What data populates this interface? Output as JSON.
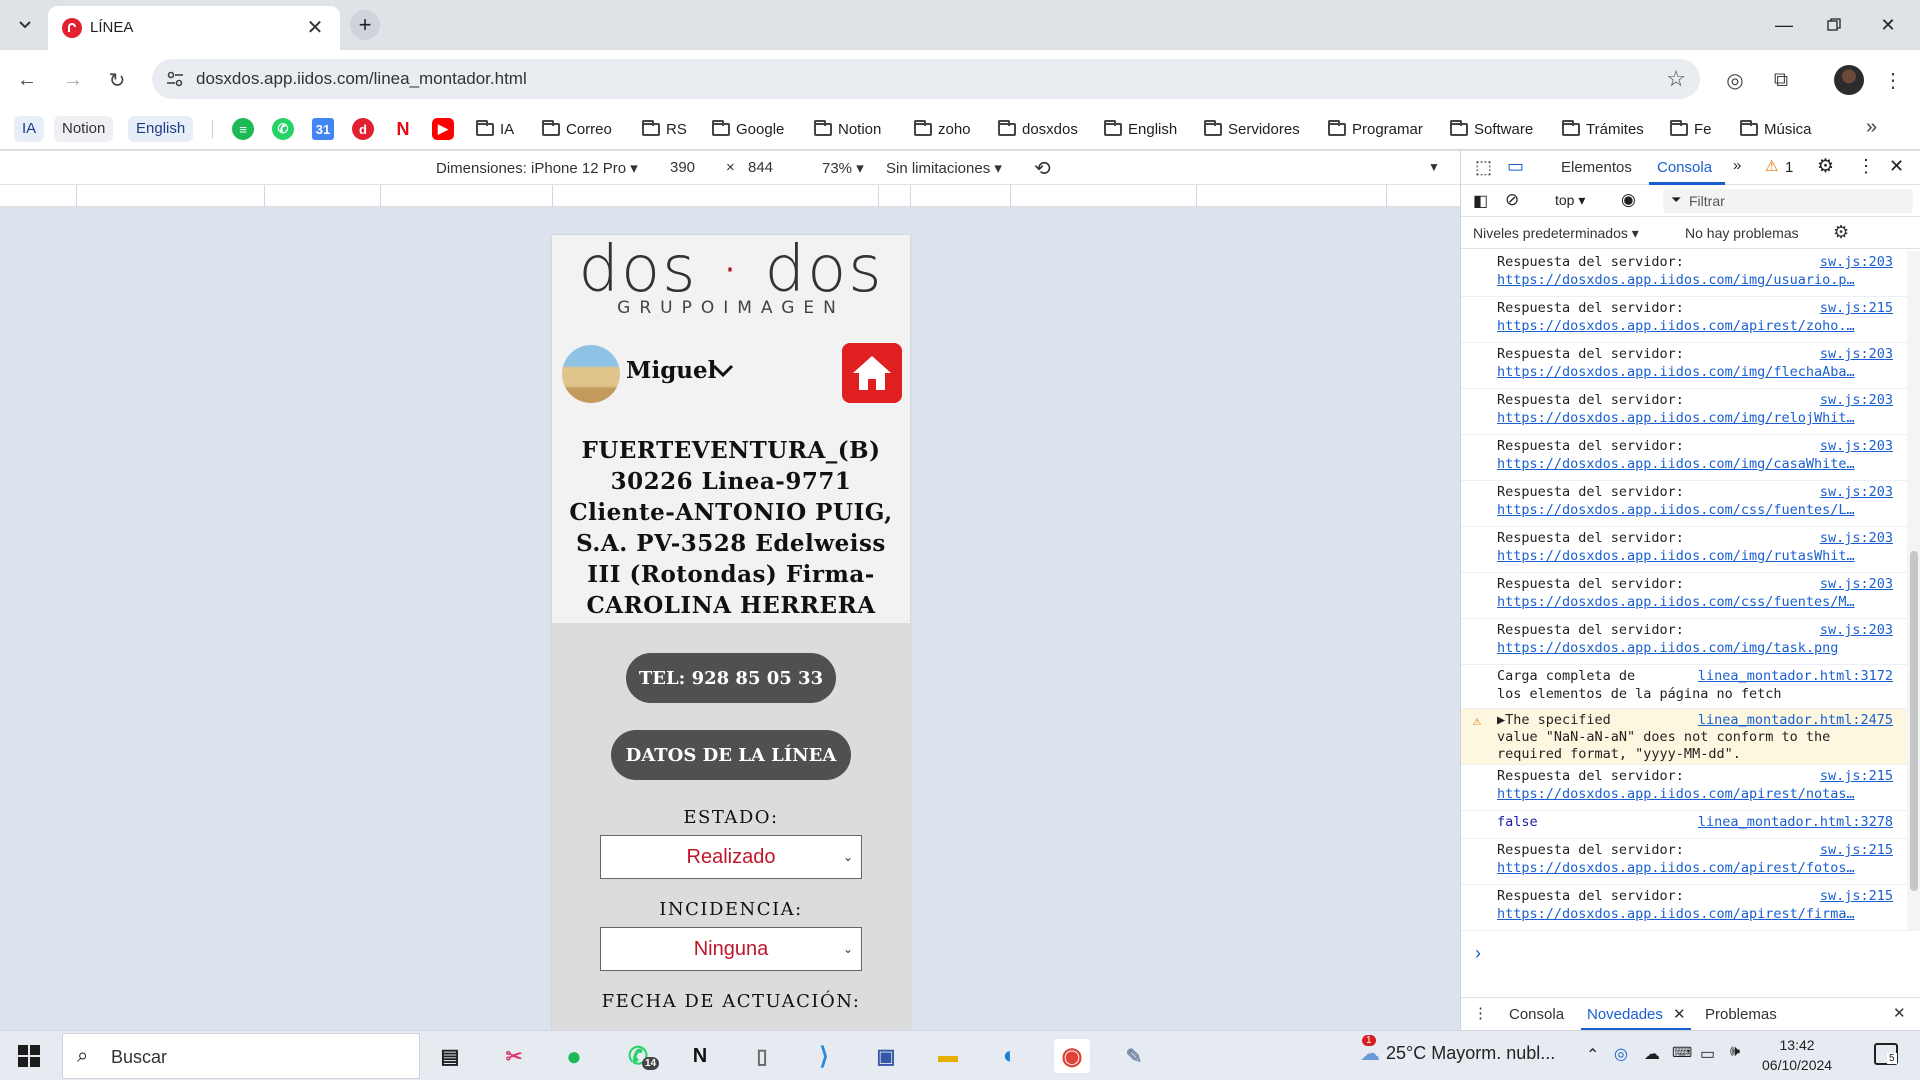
{
  "browser": {
    "tab_title": "LÍNEA",
    "url": "dosxdos.app.iidos.com/linea_montador.html",
    "new_tab_symbol": "+",
    "close_symbol": "✕"
  },
  "bookmarks": {
    "chips": [
      "IA",
      "Notion",
      "English"
    ],
    "folders": [
      "IA",
      "Correo",
      "RS",
      "Google",
      "Notion",
      "zoho",
      "dosxdos",
      "English",
      "Servidores",
      "Programar",
      "Software",
      "Trámites",
      "Fe",
      "Música"
    ],
    "overflow": "»"
  },
  "device_toolbar": {
    "dimensions_label": "Dimensiones: iPhone 12 Pro ▾",
    "width": "390",
    "times": "×",
    "height": "844",
    "zoom": "73% ▾",
    "throttle": "Sin limitaciones ▾"
  },
  "page": {
    "logo_left": "dos",
    "logo_dot": "·",
    "logo_right": "dos",
    "logo_sub": "GRUPOIMAGEN",
    "user_name": "Miguel",
    "line_title": "FUERTEVENTURA_(B) 30226 Linea-9771 Cliente-ANTONIO PUIG, S.A. PV-3528 Edelweiss III (Rotondas) Firma-CAROLINA HERRERA",
    "tel_button": "TEL: 928 85 05 33",
    "datos_button": "DATOS DE LA LÍNEA",
    "estado_label": "ESTADO:",
    "estado_value": "Realizado",
    "incidencia_label": "INCIDENCIA:",
    "incidencia_value": "Ninguna",
    "fecha_label": "FECHA DE ACTUACIÓN:"
  },
  "devtools": {
    "tabs": [
      "Elementos",
      "Consola"
    ],
    "warning_count": "1",
    "context": "top ▾",
    "filter_placeholder": "Filtrar",
    "levels": "Niveles predeterminados ▾",
    "issues": "No hay problemas",
    "logs": [
      {
        "msg": "Respuesta del servidor:",
        "src": "sw.js:203",
        "url": "https://dosxdos.app.iidos.com/img/usuario.p…"
      },
      {
        "msg": "Respuesta del servidor:",
        "src": "sw.js:215",
        "url": "https://dosxdos.app.iidos.com/apirest/zoho.…"
      },
      {
        "msg": "Respuesta del servidor:",
        "src": "sw.js:203",
        "url": "https://dosxdos.app.iidos.com/img/flechaAba…"
      },
      {
        "msg": "Respuesta del servidor:",
        "src": "sw.js:203",
        "url": "https://dosxdos.app.iidos.com/img/relojWhit…"
      },
      {
        "msg": "Respuesta del servidor:",
        "src": "sw.js:203",
        "url": "https://dosxdos.app.iidos.com/img/casaWhite…"
      },
      {
        "msg": "Respuesta del servidor:",
        "src": "sw.js:203",
        "url": "https://dosxdos.app.iidos.com/css/fuentes/L…"
      },
      {
        "msg": "Respuesta del servidor:",
        "src": "sw.js:203",
        "url": "https://dosxdos.app.iidos.com/img/rutasWhit…"
      },
      {
        "msg": "Respuesta del servidor:",
        "src": "sw.js:203",
        "url": "https://dosxdos.app.iidos.com/css/fuentes/M…"
      },
      {
        "msg": "Respuesta del servidor:",
        "src": "sw.js:203",
        "url": "https://dosxdos.app.iidos.com/img/task.png"
      }
    ],
    "log_carga": {
      "msg": "Carga completa de",
      "msg2": "los elementos de la página no fetch",
      "src": "linea_montador.html:3172"
    },
    "log_warn": {
      "msg": "▶The specified",
      "msg2": "value \"NaN-aN-aN\" does not conform to the",
      "msg3": "required format, \"yyyy-MM-dd\".",
      "src": "linea_montador.html:2475"
    },
    "log_notas": {
      "msg": "Respuesta del servidor:",
      "src": "sw.js:215",
      "url": "https://dosxdos.app.iidos.com/apirest/notas…"
    },
    "log_false": {
      "msg": "false",
      "src": "linea_montador.html:3278"
    },
    "log_fotos": {
      "msg": "Respuesta del servidor:",
      "src": "sw.js:215",
      "url": "https://dosxdos.app.iidos.com/apirest/fotos…"
    },
    "log_firma": {
      "msg": "Respuesta del servidor:",
      "src": "sw.js:215",
      "url": "https://dosxdos.app.iidos.com/apirest/firma…"
    },
    "prompt": "›",
    "drawer_tabs": [
      "Consola",
      "Novedades",
      "Problemas"
    ]
  },
  "taskbar": {
    "search_text": "Buscar",
    "whatsapp_badge": "14",
    "weather": "25°C  Mayorm. nubl...",
    "weather_badge": "1",
    "time": "13:42",
    "date": "06/10/2024",
    "notif_count": "5"
  }
}
